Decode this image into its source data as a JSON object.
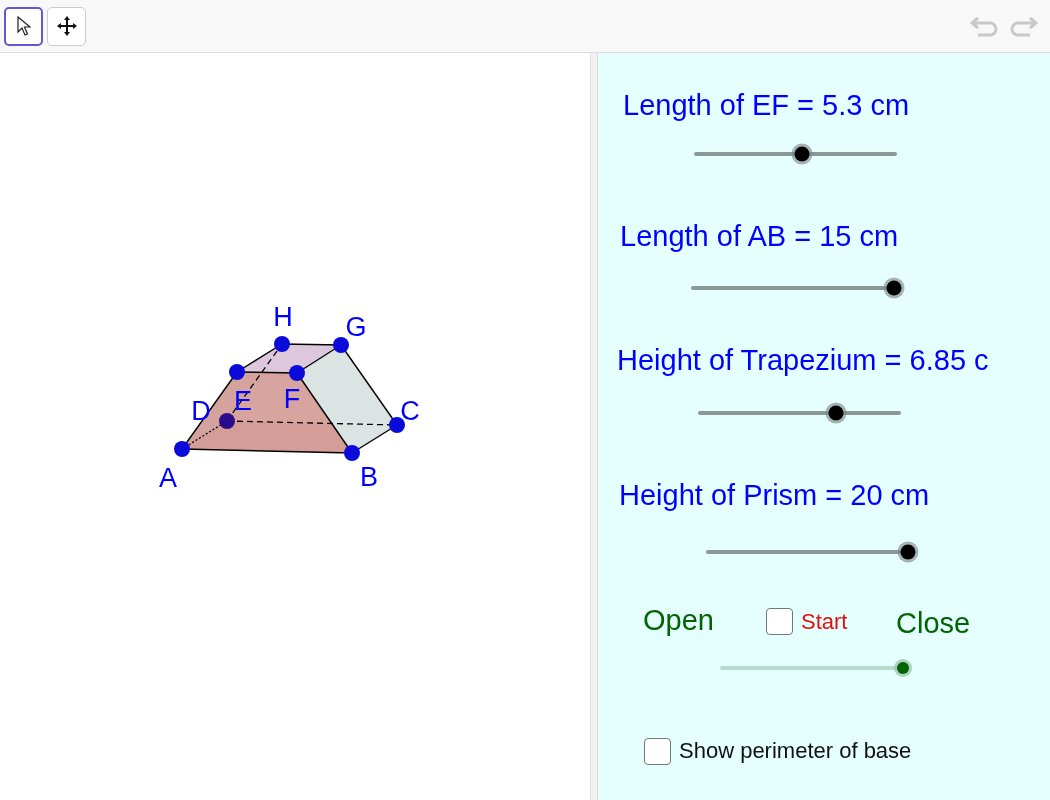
{
  "toolbar": {
    "tools": [
      {
        "kind": "pointer",
        "selected": true
      },
      {
        "kind": "move",
        "selected": false
      }
    ]
  },
  "graphics": {
    "points": [
      {
        "label": "H"
      },
      {
        "label": "G"
      },
      {
        "label": "D"
      },
      {
        "label": "E"
      },
      {
        "label": "F"
      },
      {
        "label": "C"
      },
      {
        "label": "A"
      },
      {
        "label": "B"
      }
    ]
  },
  "sliders": [
    {
      "label": "Length of EF = 5.3 cm",
      "level": 0.53
    },
    {
      "label": "Length of AB = 15 cm",
      "level": 1.0
    },
    {
      "label": "Height of Trapezium = 6.85 c",
      "level": 0.68
    },
    {
      "label": "Height of Prism = 20 cm",
      "level": 1.0
    }
  ],
  "net": {
    "open_label": "Open",
    "close_label": "Close",
    "start": {
      "label": "Start",
      "checked": false
    },
    "level": 1.0
  },
  "perimeter_checkbox": {
    "label": "Show perimeter of base",
    "checked": false
  }
}
